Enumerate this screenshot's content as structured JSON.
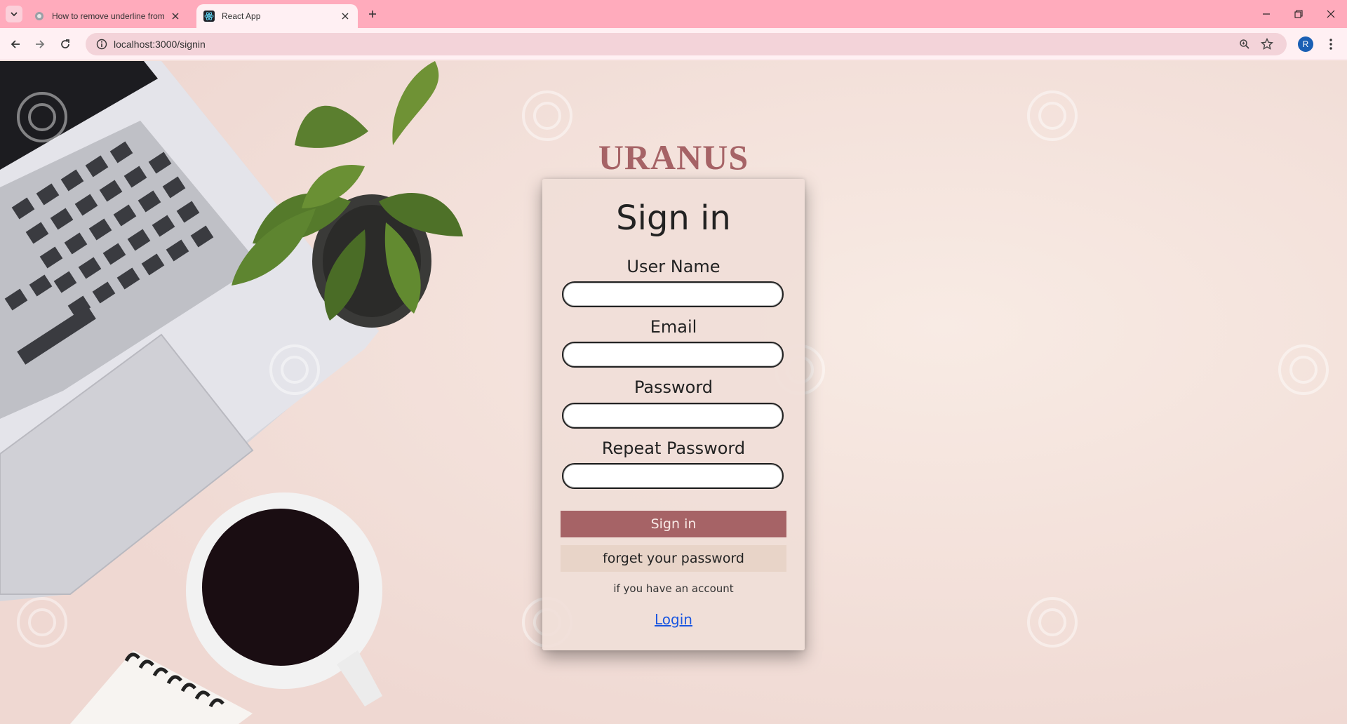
{
  "browser": {
    "tabs": [
      {
        "title": "How to remove underline from",
        "active": false,
        "favicon": "globe-icon"
      },
      {
        "title": "React App",
        "active": true,
        "favicon": "react-icon"
      }
    ],
    "url": "localhost:3000/signin",
    "profile_initial": "R"
  },
  "page": {
    "brand": "URANUS",
    "card": {
      "title": "Sign in",
      "fields": [
        {
          "label": "User Name",
          "value": ""
        },
        {
          "label": "Email",
          "value": ""
        },
        {
          "label": "Password",
          "value": ""
        },
        {
          "label": "Repeat Password",
          "value": ""
        }
      ],
      "signin_button": "Sign in",
      "forget_button": "forget your password",
      "account_text": "if you have an account",
      "login_link": "Login"
    },
    "colors": {
      "brand": "#a66366",
      "signin_button": "#a66366",
      "forget_button": "#e8d4c8",
      "tab_bar": "#ffabbc",
      "link": "#1a56e0"
    }
  }
}
